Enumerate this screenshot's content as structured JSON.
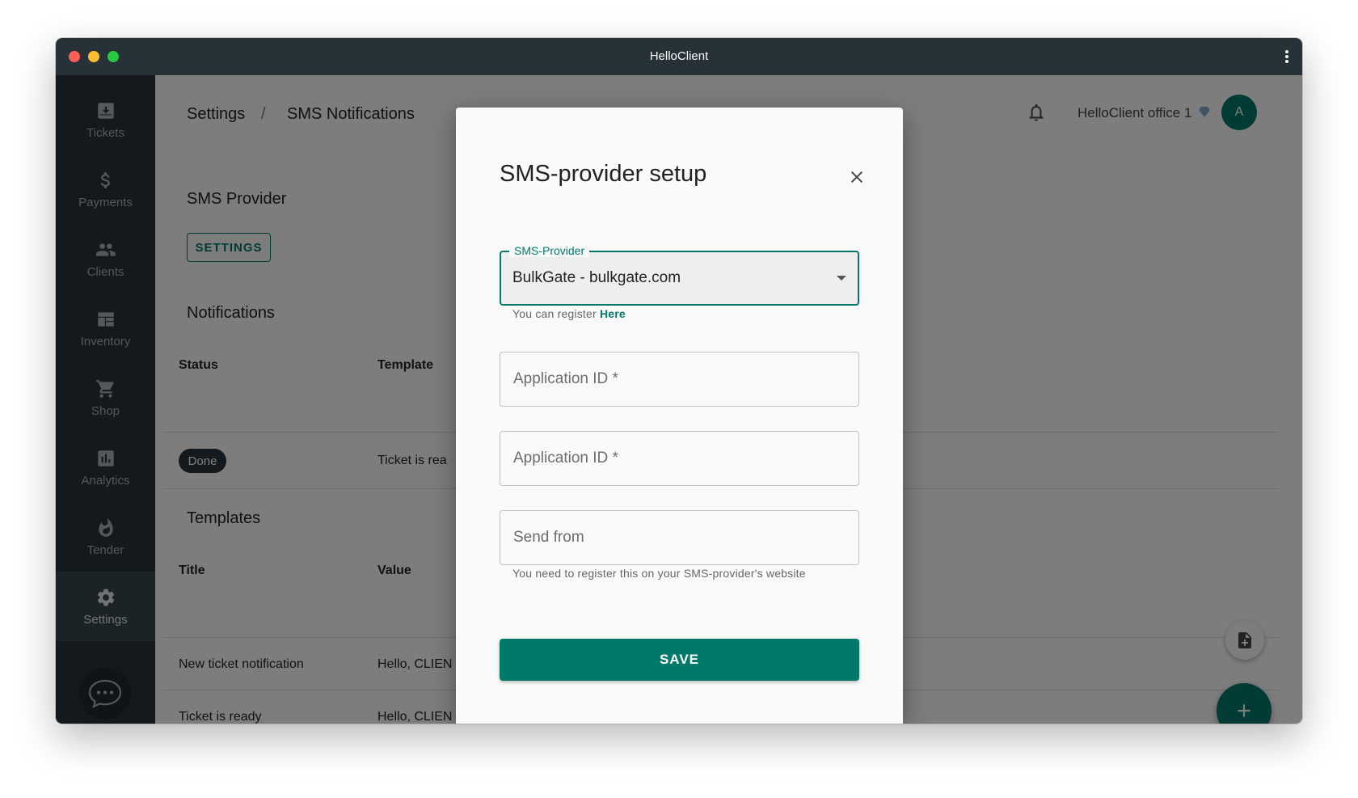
{
  "window": {
    "title": "HelloClient"
  },
  "sidebar": {
    "items": [
      {
        "label": "Tickets",
        "icon": "ticket-icon"
      },
      {
        "label": "Payments",
        "icon": "dollar-icon"
      },
      {
        "label": "Clients",
        "icon": "people-icon"
      },
      {
        "label": "Inventory",
        "icon": "inventory-icon"
      },
      {
        "label": "Shop",
        "icon": "cart-icon"
      },
      {
        "label": "Analytics",
        "icon": "chart-icon"
      },
      {
        "label": "Tender",
        "icon": "flame-icon"
      },
      {
        "label": "Settings",
        "icon": "gear-icon",
        "active": true
      }
    ]
  },
  "header": {
    "breadcrumb": [
      "Settings",
      "/",
      "SMS Notifications"
    ],
    "account": "HelloClient office 1",
    "avatar_initial": "A"
  },
  "main": {
    "provider_section": "SMS Provider",
    "settings_button": "SETTINGS",
    "notifications_section": "Notifications",
    "notifications_columns": [
      "Status",
      "Template"
    ],
    "notifications_rows": [
      {
        "status": "Done",
        "template": "Ticket is rea"
      }
    ],
    "templates_section": "Templates",
    "templates_columns": [
      "Title",
      "Value"
    ],
    "templates_rows": [
      {
        "title": "New ticket notification",
        "value": "Hello, CLIEN"
      },
      {
        "title": "Ticket is ready",
        "value": "Hello, CLIEN"
      }
    ]
  },
  "dialog": {
    "title": "SMS-provider setup",
    "provider_label": "SMS-Provider",
    "provider_value": "BulkGate - bulkgate.com",
    "register_text": "You can register",
    "register_link": "Here",
    "app_id_1_placeholder": "Application ID *",
    "app_id_2_placeholder": "Application ID *",
    "send_from_placeholder": "Send from",
    "send_from_helper": "You need to register this on your SMS-provider's website",
    "save_label": "SAVE"
  },
  "colors": {
    "accent": "#00796b",
    "sidebar": "#263238",
    "sidebar_active": "#37474f"
  }
}
